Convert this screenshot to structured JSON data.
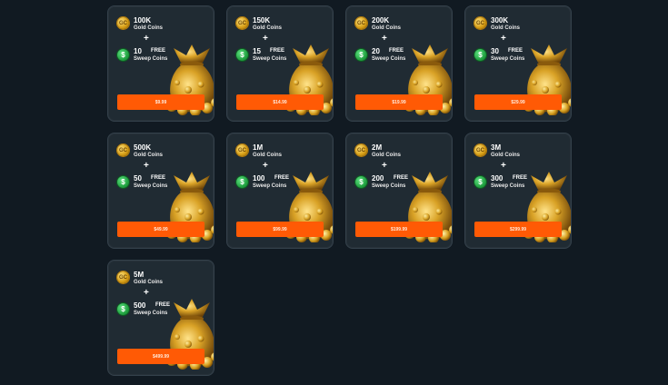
{
  "coin_icon_glyph": "GC",
  "sweep_icon_glyph": "$",
  "plus_symbol": "+",
  "gold_label": "Gold Coins",
  "free_label": "FREE",
  "sweep_label": "Sweep Coins",
  "colors": {
    "background": "#111a22",
    "card": "#202b33",
    "button": "#ff5a05",
    "gold": "#d39a12",
    "sweep": "#1f9e3e"
  },
  "packages": [
    {
      "gold": "100K",
      "sweep": "10",
      "price": "$9.99"
    },
    {
      "gold": "150K",
      "sweep": "15",
      "price": "$14.99"
    },
    {
      "gold": "200K",
      "sweep": "20",
      "price": "$19.99"
    },
    {
      "gold": "300K",
      "sweep": "30",
      "price": "$29.99"
    },
    {
      "gold": "500K",
      "sweep": "50",
      "price": "$49.99"
    },
    {
      "gold": "1M",
      "sweep": "100",
      "price": "$99.99"
    },
    {
      "gold": "2M",
      "sweep": "200",
      "price": "$199.99"
    },
    {
      "gold": "3M",
      "sweep": "300",
      "price": "$299.99"
    },
    {
      "gold": "5M",
      "sweep": "500",
      "price": "$499.99"
    }
  ]
}
